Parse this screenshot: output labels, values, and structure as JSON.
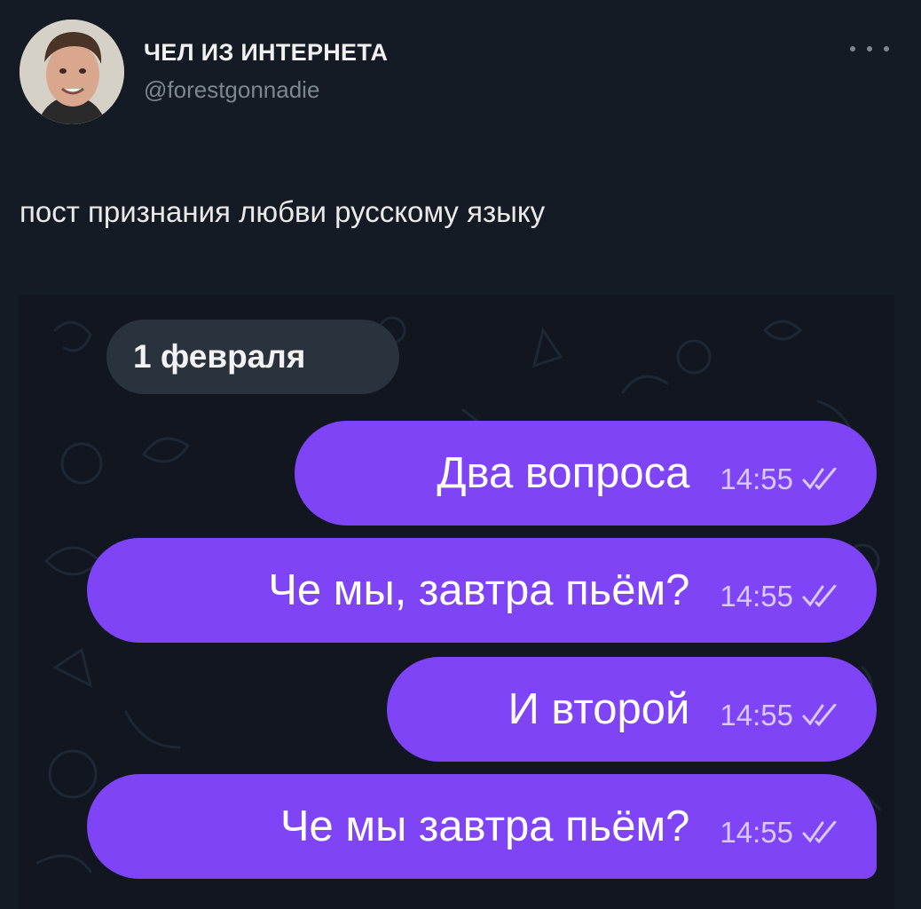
{
  "profile": {
    "name": "ЧЕЛ ИЗ ИНТЕРНЕТА",
    "handle": "@forestgonnadie",
    "avatar_icon": "user-photo-avatar",
    "more_icon": "more-horizontal-icon"
  },
  "tweet": {
    "text": "пост признания любви русскому языку"
  },
  "chat": {
    "date": "1 февраля",
    "bubble_color": "#7e44f5",
    "background_color": "#111621",
    "messages": [
      {
        "text": "Два вопроса",
        "time": "14:55",
        "status_icon": "double-check-icon"
      },
      {
        "text": "Че мы, завтра пьём?",
        "time": "14:55",
        "status_icon": "double-check-icon"
      },
      {
        "text": "И второй",
        "time": "14:55",
        "status_icon": "double-check-icon"
      },
      {
        "text": "Че мы завтра пьём?",
        "time": "14:55",
        "status_icon": "double-check-icon"
      }
    ]
  }
}
